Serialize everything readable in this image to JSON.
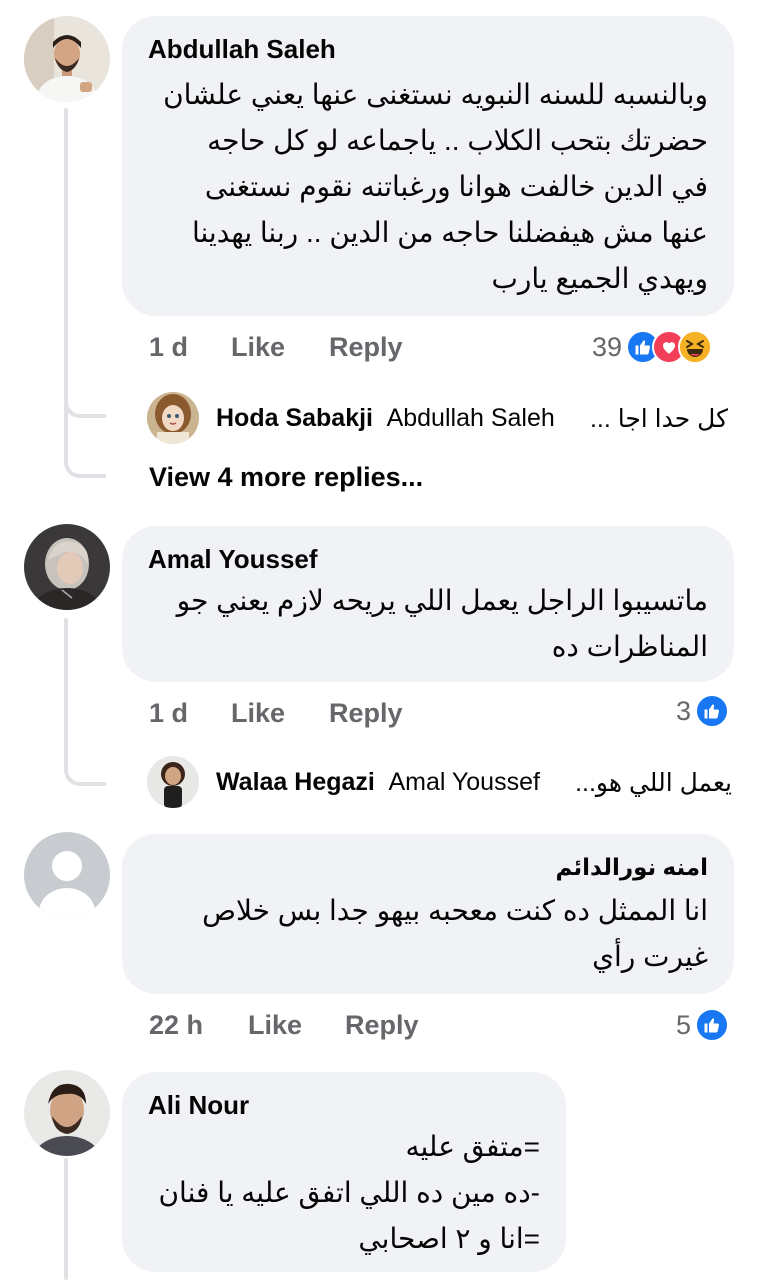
{
  "comments": [
    {
      "author": "Abdullah Saleh",
      "lines": [
        "وبالنسبه للسنه النبويه نستغنى عنها يعني علشان",
        "حضرتك بتحب الكلاب .. ياجماعه لو كل حاجه",
        "في الدين خالفت هوانا ورغباتنه نقوم نستغنى",
        "عنها مش هيفضلنا حاجه من الدين .. ربنا يهدينا",
        "ويهدي الجميع يارب"
      ],
      "time": "1 d",
      "like": "Like",
      "reply": "Reply",
      "reaction_count": "39",
      "reactions": [
        "like-icon",
        "love-icon",
        "haha-icon"
      ],
      "reply_preview": {
        "author": "Hoda Sabakji",
        "mention": "Abdullah Saleh",
        "text": "كل حدا اجا ..."
      },
      "more_replies": "View 4 more replies..."
    },
    {
      "author": "Amal Youssef",
      "lines": [
        "ماتسيبوا الراجل يعمل اللي يريحه لازم يعني جو",
        "المناظرات ده"
      ],
      "time": "1 d",
      "like": "Like",
      "reply": "Reply",
      "reaction_count": "3",
      "reactions": [
        "like-icon"
      ],
      "reply_preview": {
        "author": "Walaa Hegazi",
        "mention": "Amal Youssef",
        "text": "يعمل اللي هو..."
      }
    },
    {
      "author": "امنه نورالدائم",
      "lines": [
        "انا الممثل ده كنت معحبه بيهو جدا بس خلاص",
        "غيرت رأي"
      ],
      "time": "22 h",
      "like": "Like",
      "reply": "Reply",
      "reaction_count": "5",
      "reactions": [
        "like-icon"
      ]
    },
    {
      "author": "Ali Nour",
      "lines": [
        "=متفق عليه",
        "-ده مين ده اللي اتفق عليه يا فنان",
        "=انا و ٢ اصحابي"
      ]
    }
  ],
  "colors": {
    "bubble": "#f0f2f5",
    "secondary_text": "#65676b",
    "like_blue": "#1877f2",
    "love_red": "#f33e58",
    "haha_yellow": "#f7b125",
    "thread_line": "#dfe1e5"
  }
}
